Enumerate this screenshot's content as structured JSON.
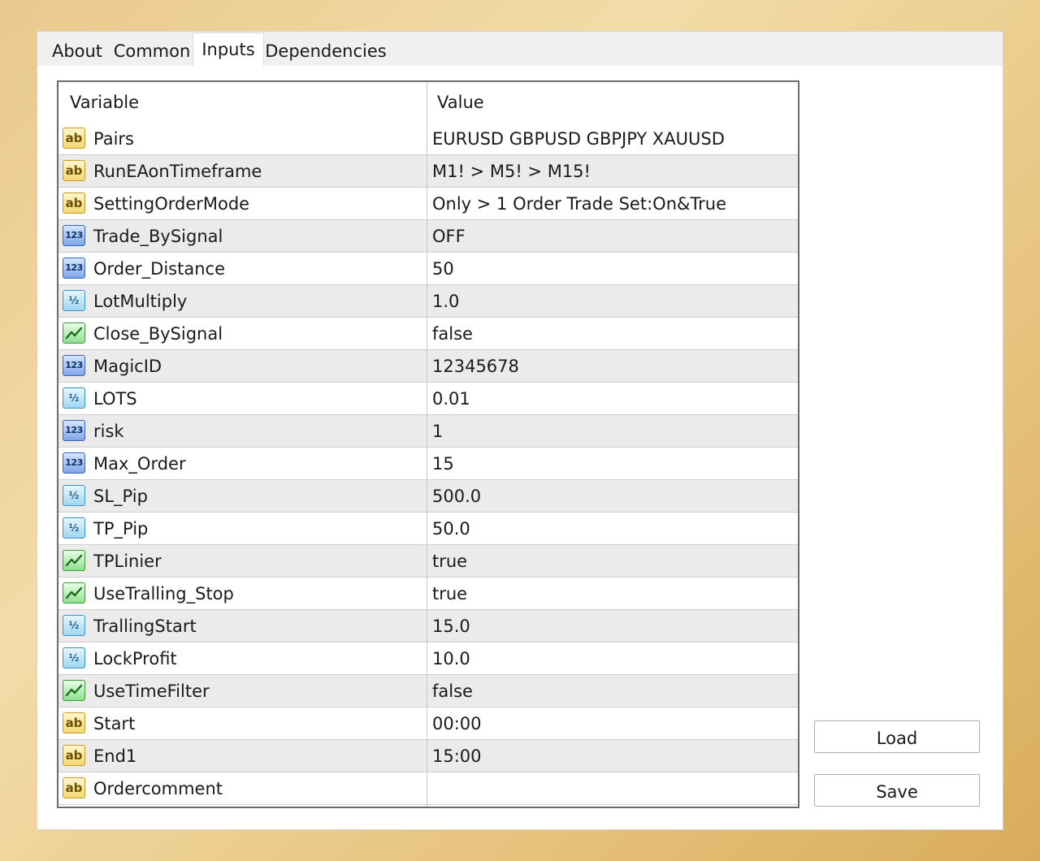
{
  "tabs": [
    {
      "label": "About"
    },
    {
      "label": "Common"
    },
    {
      "label": "Inputs"
    },
    {
      "label": "Dependencies"
    }
  ],
  "active_tab": "Inputs",
  "grid": {
    "header_variable": "Variable",
    "header_value": "Value",
    "rows": [
      {
        "icon": "string-type-icon",
        "variable": "Pairs",
        "value": "EURUSD GBPUSD GBPJPY XAUUSD"
      },
      {
        "icon": "string-type-icon",
        "variable": "RunEAonTimeframe",
        "value": "M1! > M5! > M15!"
      },
      {
        "icon": "string-type-icon",
        "variable": "SettingOrderMode",
        "value": "Only > 1 Order Trade Set:On&True"
      },
      {
        "icon": "integer-type-icon",
        "variable": "Trade_BySignal",
        "value": "OFF"
      },
      {
        "icon": "integer-type-icon",
        "variable": "Order_Distance",
        "value": "50"
      },
      {
        "icon": "double-type-icon",
        "variable": "LotMultiply",
        "value": "1.0"
      },
      {
        "icon": "bool-type-icon",
        "variable": "Close_BySignal",
        "value": "false"
      },
      {
        "icon": "integer-type-icon",
        "variable": "MagicID",
        "value": "12345678"
      },
      {
        "icon": "double-type-icon",
        "variable": "LOTS",
        "value": "0.01"
      },
      {
        "icon": "integer-type-icon",
        "variable": "risk",
        "value": "1"
      },
      {
        "icon": "integer-type-icon",
        "variable": "Max_Order",
        "value": "15"
      },
      {
        "icon": "double-type-icon",
        "variable": "SL_Pip",
        "value": "500.0"
      },
      {
        "icon": "double-type-icon",
        "variable": "TP_Pip",
        "value": "50.0"
      },
      {
        "icon": "bool-type-icon",
        "variable": "TPLinier",
        "value": "true"
      },
      {
        "icon": "bool-type-icon",
        "variable": "UseTralling_Stop",
        "value": "true"
      },
      {
        "icon": "double-type-icon",
        "variable": "TrallingStart",
        "value": "15.0"
      },
      {
        "icon": "double-type-icon",
        "variable": "LockProfit",
        "value": "10.0"
      },
      {
        "icon": "bool-type-icon",
        "variable": "UseTimeFilter",
        "value": "false"
      },
      {
        "icon": "string-type-icon",
        "variable": "Start",
        "value": "00:00"
      },
      {
        "icon": "string-type-icon",
        "variable": "End1",
        "value": "15:00"
      },
      {
        "icon": "string-type-icon",
        "variable": "Ordercomment",
        "value": ""
      }
    ]
  },
  "icon_glyphs": {
    "string": "ab",
    "integer": "123",
    "double": "½"
  },
  "buttons": {
    "load_label": "Load",
    "save_label": "Save"
  }
}
